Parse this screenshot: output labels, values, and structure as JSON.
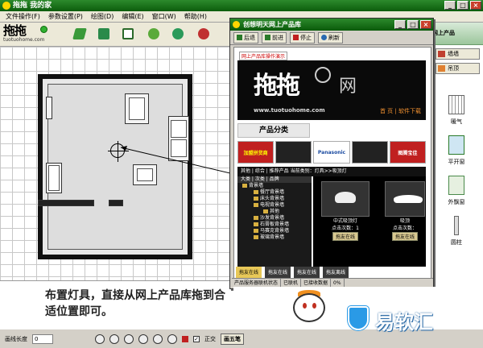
{
  "window": {
    "title": "拖拖 我的家"
  },
  "menu": [
    "文件操作(F)",
    "参数设置(P)",
    "绘图(D)",
    "编辑(E)",
    "窗口(W)",
    "帮助(H)"
  ],
  "logo": {
    "glyphs": "拖拖",
    "url": "tuotuohome.com"
  },
  "caption": "布置灯具，直接从网上产品库拖到合适位置即可。",
  "status": {
    "line_length_label": "画线长度",
    "line_length_value": "0",
    "ortho_label": "正交",
    "tab_label": "画五笔"
  },
  "right_panel": {
    "header": "网上产品",
    "tabs": [
      "墙墙",
      "吊顶"
    ],
    "items": [
      "暖气",
      "平开窗",
      "外飘窗",
      "圆柱"
    ]
  },
  "popup": {
    "title": "创想明天网上产品库",
    "nav": {
      "back": "后退",
      "forward": "前进",
      "stop": "停止",
      "refresh": "刷新"
    },
    "demo_label": "网上产品库操作演示",
    "banner": {
      "net_char": "网",
      "url": "www.tuotuohome.com",
      "links": "首 页 | 软件下载"
    },
    "category_title": "产品分类",
    "brands": [
      "加盟拼货商",
      "",
      "Panasonic",
      "",
      "图腾宝佳"
    ],
    "tabs_text": "其他 | 综合 | 推荐产品   当前类别：灯具>>吸顶灯",
    "tree": {
      "header": "大类 | 次类 | 品牌",
      "items": [
        "背景墙",
        "餐厅背景墙",
        "床头背景墙",
        "电视背景墙",
        "其他",
        "沙发背景墙",
        "石膏板背景墙",
        "马赛克背景墙",
        "玻璃背景墙"
      ]
    },
    "products": [
      {
        "name": "中式吸顶灯",
        "clicks": "点击次数：1",
        "button": "拖友在线"
      },
      {
        "name": "吸顶",
        "clicks": "点击次数：",
        "button": "拖友在线"
      }
    ],
    "bottom_tabs": [
      "拖友在线",
      "拖友在线",
      "拖友在线",
      "拖友离线"
    ],
    "statusbar": [
      "产品服务器联机状态",
      "已联机",
      "已接收数据",
      "0%"
    ]
  },
  "colors": {
    "title_green": "#0c5c0c",
    "accent_yellow": "#ffd600",
    "watermark_blue": "#2a9ae6"
  },
  "watermark": {
    "text": "易软汇"
  }
}
